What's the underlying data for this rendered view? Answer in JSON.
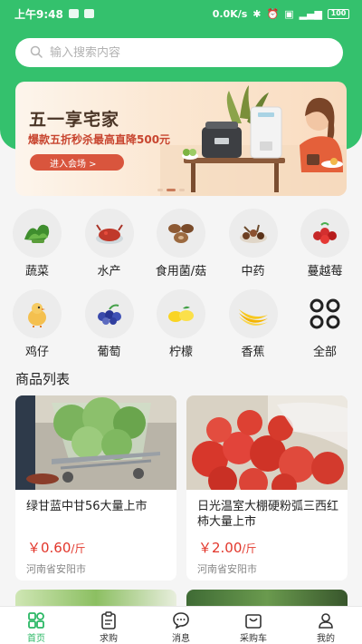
{
  "status_bar": {
    "time": "上午9:48",
    "speed": "0.0K/s",
    "battery": "100"
  },
  "search": {
    "placeholder": "输入搜索内容"
  },
  "banner": {
    "title": "五一享宅家",
    "subtitle": "爆款五折秒杀最高直降500元",
    "button": "进入会场 >",
    "dots": 3,
    "active_dot": 1
  },
  "categories": [
    {
      "label": "蔬菜",
      "icon": "vegetable-icon"
    },
    {
      "label": "水产",
      "icon": "seafood-icon"
    },
    {
      "label": "食用菌/菇",
      "icon": "mushroom-icon"
    },
    {
      "label": "中药",
      "icon": "herb-icon"
    },
    {
      "label": "蔓越莓",
      "icon": "cranberry-icon"
    },
    {
      "label": "鸡仔",
      "icon": "chick-icon"
    },
    {
      "label": "葡萄",
      "icon": "grape-icon"
    },
    {
      "label": "柠檬",
      "icon": "lemon-icon"
    },
    {
      "label": "香蕉",
      "icon": "banana-icon"
    },
    {
      "label": "全部",
      "icon": "grid-all-icon"
    }
  ],
  "section_title": "商品列表",
  "products": [
    {
      "name": "绿甘蓝中甘56大量上市",
      "price": "￥0.60",
      "unit": "/斤",
      "location": "河南省安阳市"
    },
    {
      "name": "日光温室大棚硬粉弧三西红柿大量上市",
      "price": "￥2.00",
      "unit": "/斤",
      "location": "河南省安阳市"
    }
  ],
  "tabs": [
    {
      "label": "首页",
      "icon": "home-icon",
      "active": true
    },
    {
      "label": "求购",
      "icon": "clipboard-icon",
      "active": false
    },
    {
      "label": "消息",
      "icon": "message-icon",
      "active": false
    },
    {
      "label": "采购车",
      "icon": "cart-icon",
      "active": false
    },
    {
      "label": "我的",
      "icon": "user-icon",
      "active": false
    }
  ],
  "colors": {
    "primary": "#34c16d",
    "price": "#e2362b",
    "tab_active": "#2bb865"
  }
}
